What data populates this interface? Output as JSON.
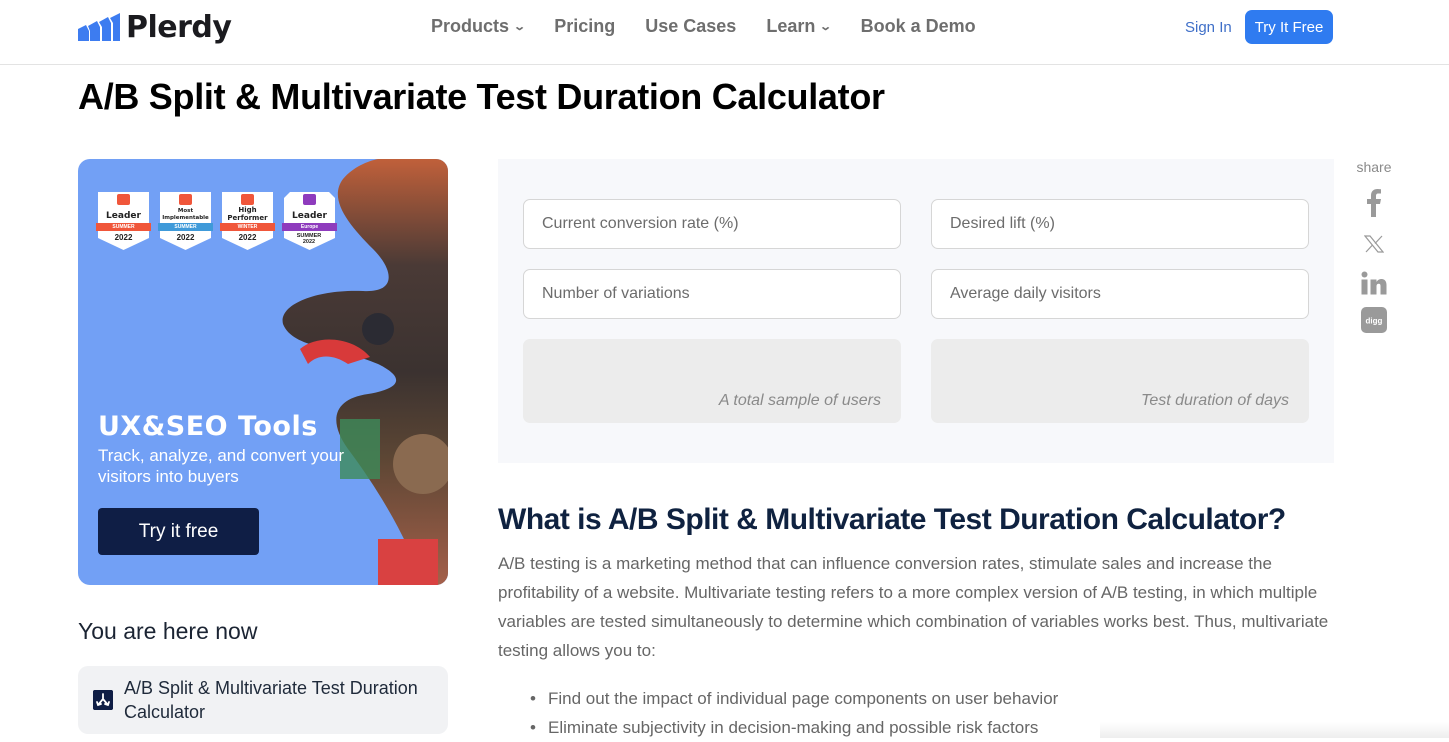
{
  "header": {
    "logo_text": "Plerdy",
    "nav": [
      {
        "label": "Products",
        "has_dropdown": true
      },
      {
        "label": "Pricing",
        "has_dropdown": false
      },
      {
        "label": "Use Cases",
        "has_dropdown": false
      },
      {
        "label": "Learn",
        "has_dropdown": true
      },
      {
        "label": "Book a Demo",
        "has_dropdown": false
      }
    ],
    "sign_in": "Sign In",
    "try_free": "Try It Free",
    "accent": "#2f7bf0"
  },
  "page": {
    "title": "A/B Split & Multivariate Test Duration Calculator"
  },
  "promo": {
    "badges": [
      {
        "title": "Leader",
        "ribbon": "SUMMER",
        "year": "2022",
        "ribbon_color": "#f0563a"
      },
      {
        "title": "Most Implementable",
        "ribbon": "SUMMER",
        "year": "2022",
        "ribbon_color": "#3f9ad9"
      },
      {
        "title": "High Performer",
        "ribbon": "WINTER",
        "year": "2022",
        "ribbon_color": "#f0563a"
      },
      {
        "title": "Leader",
        "ribbon": "Europe",
        "year": "SUMMER 2022",
        "ribbon_color": "#8e3bbd"
      }
    ],
    "title": "UX&SEO Tools",
    "subtitle": "Track, analyze, and convert your visitors into buyers",
    "button": "Try it free",
    "bg_color": "#72a0f5"
  },
  "sidebar": {
    "here_title": "You are here now",
    "current_item": "A/B Split & Multivariate Test Duration Calculator"
  },
  "calculator": {
    "fields": [
      {
        "placeholder": "Current conversion rate (%)",
        "value": ""
      },
      {
        "placeholder": "Desired lift (%)",
        "value": ""
      },
      {
        "placeholder": "Number of variations",
        "value": ""
      },
      {
        "placeholder": "Average daily visitors",
        "value": ""
      }
    ],
    "results": [
      {
        "label": "A total sample of users",
        "value": ""
      },
      {
        "label": "Test duration of days",
        "value": ""
      }
    ]
  },
  "share": {
    "label": "share",
    "icons": [
      "facebook-icon",
      "x-twitter-icon",
      "linkedin-icon",
      "digg-icon"
    ]
  },
  "article": {
    "heading": "What is A/B Split & Multivariate Test Duration Calculator?",
    "paragraph": "A/B testing is a marketing method that can influence conversion rates, stimulate sales and increase the profitability of a website. Multivariate testing refers to a more complex version of A/B testing, in which multiple variables are tested simultaneously to determine which combination of variables works best. Thus, multivariate testing allows you to:",
    "bullets": [
      "Find out the impact of individual page components on user behavior",
      "Eliminate subjectivity in decision-making and possible risk factors"
    ]
  }
}
